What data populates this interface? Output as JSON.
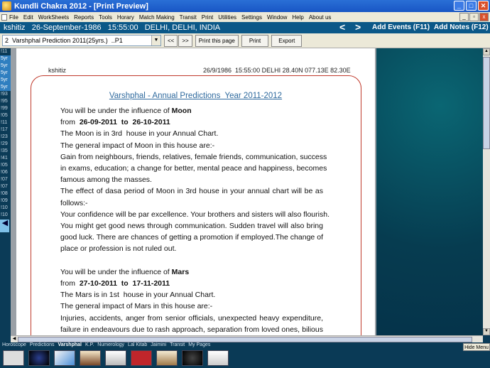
{
  "window": {
    "title": "Kundli Chakra 2012 - [Print Preview]",
    "buttons": [
      "_",
      "□",
      "✕"
    ]
  },
  "menubar": {
    "items": [
      "File",
      "Edit",
      "WorkSheets",
      "Reports",
      "Tools",
      "Horary",
      "Match Making",
      "Transit",
      "Print",
      "Utilities",
      "Settings",
      "Window",
      "Help",
      "About us"
    ],
    "mdi_buttons": [
      "_",
      "▫",
      "x"
    ]
  },
  "infobar": {
    "text": "kshitiz   26-September-1986   15:55:00   DELHI, DELHI, INDIA",
    "prev": "<",
    "next": ">",
    "add_events": "Add Events (F11)",
    "add_notes": "Add Notes (F12)"
  },
  "toolbar": {
    "select_value": "2  Varshphal Prediction 2011(25yrs.)  ..P1",
    "btn_prev": "<<",
    "btn_next": ">>",
    "btn_print_page": "Print this page",
    "btn_print": "Print",
    "btn_export": "Export"
  },
  "leftstrip": {
    "items": [
      "!11",
      "5yr",
      "5yr",
      "5yr",
      "5yr",
      "5yr",
      "!93",
      "!95",
      "!99",
      "!05",
      "!11",
      "!17",
      "!23",
      "!29",
      "!35",
      "!41",
      "!05",
      "!06",
      "!07",
      "!07",
      "!08",
      "!09",
      "!10",
      "!10"
    ],
    "selected": [
      1,
      2,
      3,
      4,
      5
    ]
  },
  "page": {
    "header_left": "kshitiz",
    "header_right": "26/9/1986  15:55:00 DELHI 28.40N 077.13E 82.30E",
    "title": "Varshphal - Annual Predictions  Year 2011-2012",
    "lines": [
      {
        "t": "You will be under the influence of ",
        "b": "Moon"
      },
      {
        "t": "from  ",
        "b": "26-09-2011  to  26-10-2011"
      },
      {
        "t": "The Moon is in 3rd  house in your Annual Chart."
      },
      {
        "t": "The general impact of Moon in this house are:-"
      },
      {
        "t": "Gain from neighbours, friends, relatives, female friends, communication, success",
        "j": true
      },
      {
        "t": "in exams, education; a change for better, mental peace and happiness, becomes",
        "j": true
      },
      {
        "t": "famous among the masses."
      },
      {
        "t": "The effect of dasa period of Moon in 3rd house in your annual chart will be as",
        "j": true
      },
      {
        "t": "follows:-"
      },
      {
        "t": "Your confidence will be par excellence. Your brothers and sisters will also flourish.",
        "j": true
      },
      {
        "t": "You might get good news through communication. Sudden travel will also bring",
        "j": true
      },
      {
        "t": "good luck. There are chances of getting a promotion if employed.The change of",
        "j": true
      },
      {
        "t": "place or profession is not ruled out."
      },
      {
        "t": ""
      },
      {
        "t": "You will be under the influence of ",
        "b": "Mars"
      },
      {
        "t": "from  ",
        "b": "27-10-2011  to  17-11-2011"
      },
      {
        "t": "The Mars is in 1st  house in your Annual Chart."
      },
      {
        "t": "The general impact of Mars in this house are:-"
      },
      {
        "t": "Injuries, accidents, anger from senior officials, unexpected heavy expenditure,",
        "j": true
      },
      {
        "t": "failure in endeavours due to rash approach, separation from loved ones, bilious",
        "j": true
      }
    ]
  },
  "bottombar": {
    "tabs": [
      "Horoscope",
      "Predictions",
      "Varshphal",
      "K.P.",
      "Numerology",
      "Lal Kitab",
      "Jaimini",
      "Transit",
      "My Pages"
    ],
    "active_tab": "Varshphal",
    "hide_menu": "Hide Menu"
  },
  "colors": {
    "title_blue": "#2f6a9e",
    "border_red": "#c0392b",
    "infobar_bg": "#0b5888"
  }
}
